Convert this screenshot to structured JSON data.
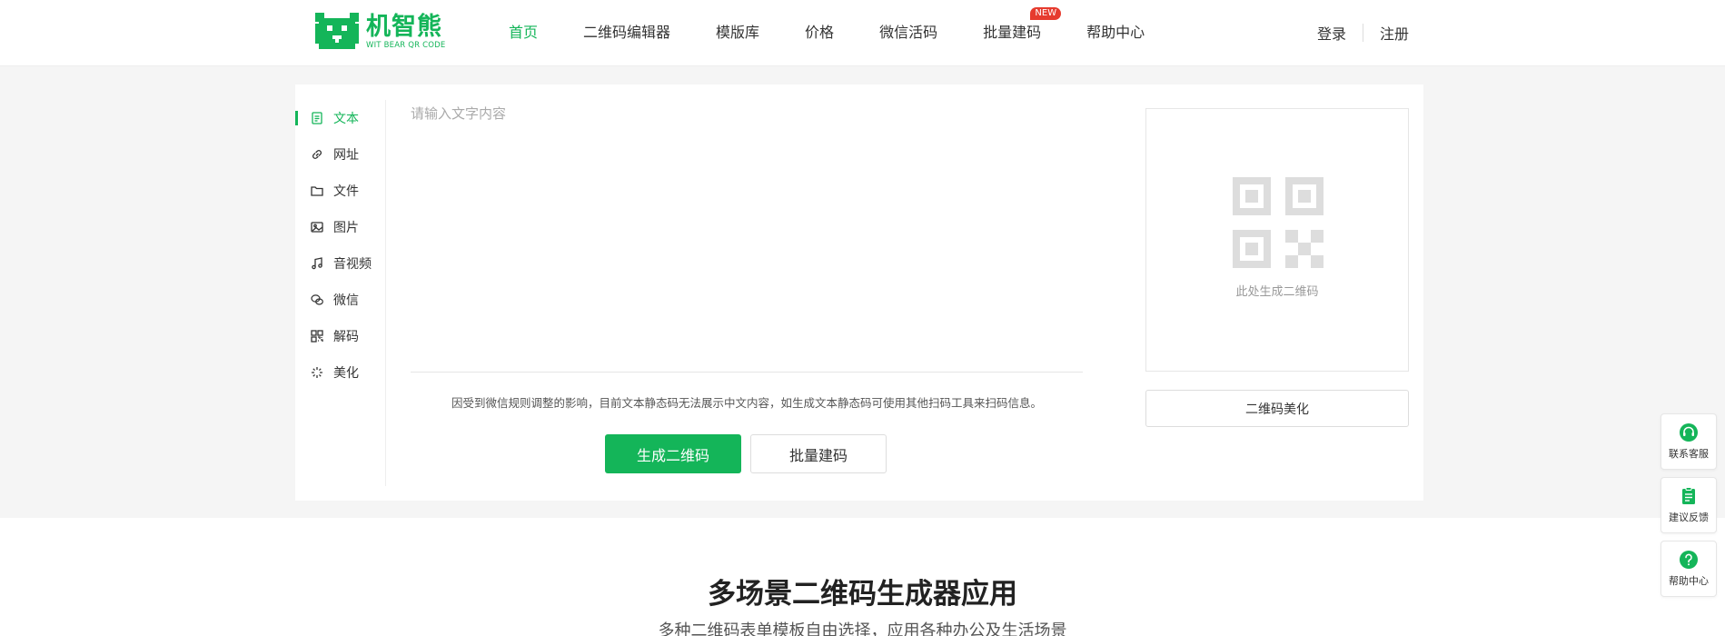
{
  "header": {
    "logo_title": "机智熊",
    "logo_sub": "WIT BEAR QR CODE",
    "nav": [
      {
        "label": "首页",
        "active": true
      },
      {
        "label": "二维码编辑器"
      },
      {
        "label": "模版库"
      },
      {
        "label": "价格"
      },
      {
        "label": "微信活码"
      },
      {
        "label": "批量建码",
        "badge": "NEW"
      },
      {
        "label": "帮助中心"
      }
    ],
    "login": "登录",
    "register": "注册"
  },
  "sidebar": {
    "items": [
      {
        "label": "文本",
        "icon": "document-icon",
        "active": true
      },
      {
        "label": "网址",
        "icon": "link-icon"
      },
      {
        "label": "文件",
        "icon": "folder-icon"
      },
      {
        "label": "图片",
        "icon": "image-icon"
      },
      {
        "label": "音视频",
        "icon": "music-icon"
      },
      {
        "label": "微信",
        "icon": "wechat-icon"
      },
      {
        "label": "解码",
        "icon": "scan-icon"
      },
      {
        "label": "美化",
        "icon": "sparkle-icon"
      }
    ]
  },
  "editor": {
    "placeholder": "请输入文字内容",
    "value": "",
    "notice": "因受到微信规则调整的影响，目前文本静态码无法展示中文内容，如生成文本静态码可使用其他扫码工具来扫码信息。",
    "generate_label": "生成二维码",
    "batch_label": "批量建码"
  },
  "preview": {
    "hint": "此处生成二维码",
    "beautify_label": "二维码美化"
  },
  "float_tools": [
    {
      "label": "联系客服",
      "icon": "headset-icon"
    },
    {
      "label": "建议反馈",
      "icon": "clipboard-icon"
    },
    {
      "label": "帮助中心",
      "icon": "help-icon"
    }
  ],
  "section": {
    "title": "多场景二维码生成器应用",
    "subtitle": "多种二维码表单模板自由选择，应用各种办公及生活场景"
  },
  "colors": {
    "brand": "#14b559",
    "badge": "#e63b2e",
    "band_bg": "#f5f5f5"
  }
}
